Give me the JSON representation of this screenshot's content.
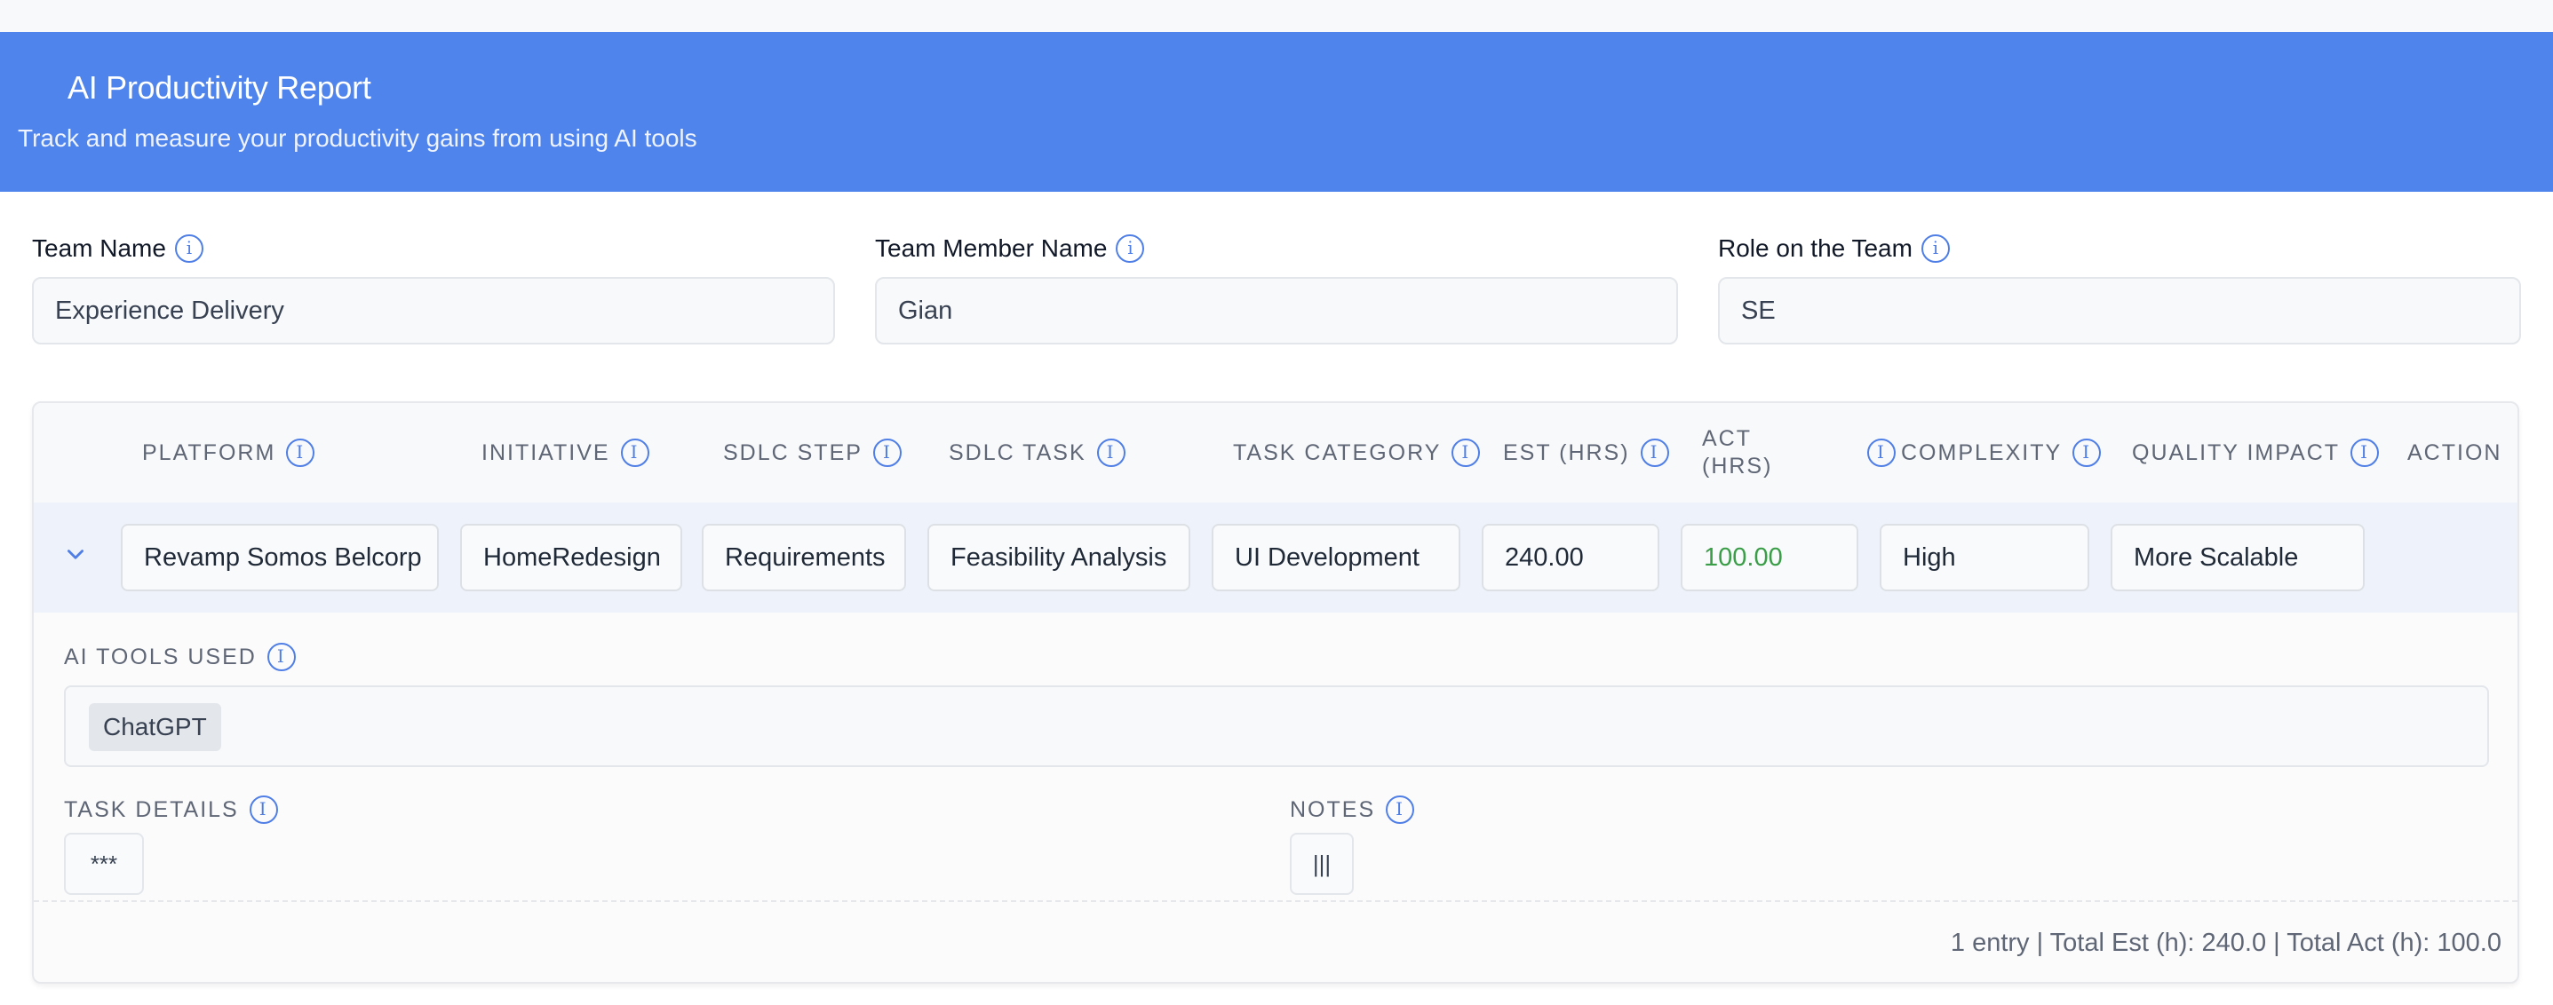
{
  "header": {
    "title": "AI Productivity Report",
    "subtitle": "Track and measure your productivity gains from using AI tools"
  },
  "fields": {
    "team_name": {
      "label": "Team Name",
      "value": "Experience Delivery"
    },
    "member_name": {
      "label": "Team Member Name",
      "value": "Gian"
    },
    "role": {
      "label": "Role on the Team",
      "value": "SE"
    }
  },
  "table": {
    "columns": {
      "platform": "PLATFORM",
      "initiative": "INITIATIVE",
      "sdlc_step": "SDLC STEP",
      "sdlc_task": "SDLC TASK",
      "task_category": "TASK CATEGORY",
      "est": "EST (HRS)",
      "act_line1": "ACT",
      "act_line2": "(HRS)",
      "complexity": "COMPLEXITY",
      "quality_impact": "QUALITY IMPACT",
      "action": "ACTION"
    },
    "row": {
      "platform": "Revamp Somos Belcorp",
      "initiative": "HomeRedesign",
      "sdlc_step": "Requirements",
      "sdlc_task": "Feasibility Analysis",
      "task_category": "UI Development",
      "est": "240.00",
      "act": "100.00",
      "complexity": "High",
      "quality_impact": "More Scalable"
    },
    "details": {
      "ai_tools_label": "AI TOOLS USED",
      "ai_tools": [
        "ChatGPT"
      ],
      "task_details_label": "TASK DETAILS",
      "task_details_value": "***",
      "notes_label": "NOTES",
      "notes_value": "|||"
    },
    "summary": "1 entry | Total Est (h): 240.0 | Total Act (h): 100.0"
  },
  "colors": {
    "banner": "#4f84ec",
    "accent": "#4f7fe6",
    "act_value": "#3a9d48"
  },
  "icons": {
    "info": "info-icon",
    "expand": "chevron-down-icon"
  }
}
